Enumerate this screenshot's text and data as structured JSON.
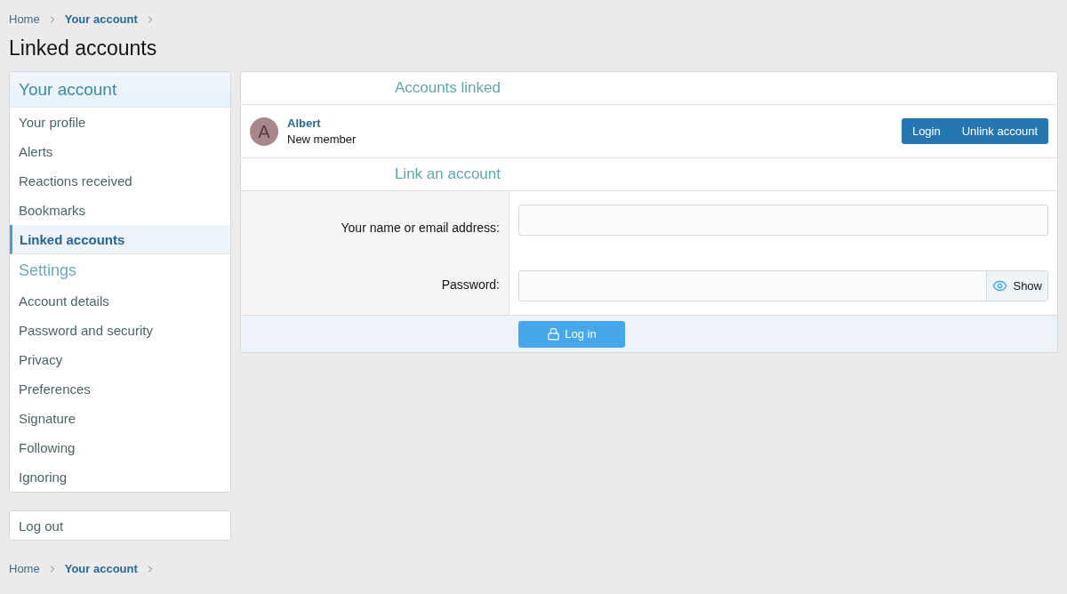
{
  "breadcrumb_top": [
    {
      "label": "Home",
      "current": false
    },
    {
      "label": "Your account",
      "current": true
    }
  ],
  "page_title": "Linked accounts",
  "sidebar": {
    "items": [
      {
        "kind": "header",
        "label": "Your account"
      },
      {
        "kind": "item",
        "label": "Your profile",
        "selected": false
      },
      {
        "kind": "item",
        "label": "Alerts",
        "selected": false
      },
      {
        "kind": "item",
        "label": "Reactions received",
        "selected": false
      },
      {
        "kind": "item",
        "label": "Bookmarks",
        "selected": false
      },
      {
        "kind": "item",
        "label": "Linked accounts",
        "selected": true
      },
      {
        "kind": "header",
        "label": "Settings"
      },
      {
        "kind": "item",
        "label": "Account details",
        "selected": false
      },
      {
        "kind": "item",
        "label": "Password and security",
        "selected": false
      },
      {
        "kind": "item",
        "label": "Privacy",
        "selected": false
      },
      {
        "kind": "item",
        "label": "Preferences",
        "selected": false
      },
      {
        "kind": "item",
        "label": "Signature",
        "selected": false
      },
      {
        "kind": "item",
        "label": "Following",
        "selected": false
      },
      {
        "kind": "item",
        "label": "Ignoring",
        "selected": false
      }
    ],
    "logout": "Log out"
  },
  "accounts_linked": {
    "heading": "Accounts linked",
    "accounts": [
      {
        "initial": "A",
        "name": "Albert",
        "role": "New member",
        "actions": [
          "Login",
          "Unlink account"
        ]
      }
    ]
  },
  "link_account": {
    "heading": "Link an account",
    "fields": [
      {
        "kind": "text",
        "label": "Your name or email address:"
      },
      {
        "kind": "password",
        "label": "Password:",
        "reveal": "Show"
      }
    ],
    "submit": "Log in"
  },
  "breadcrumb_bottom": [
    {
      "label": "Home",
      "current": false
    },
    {
      "label": "Your account",
      "current": true
    }
  ]
}
